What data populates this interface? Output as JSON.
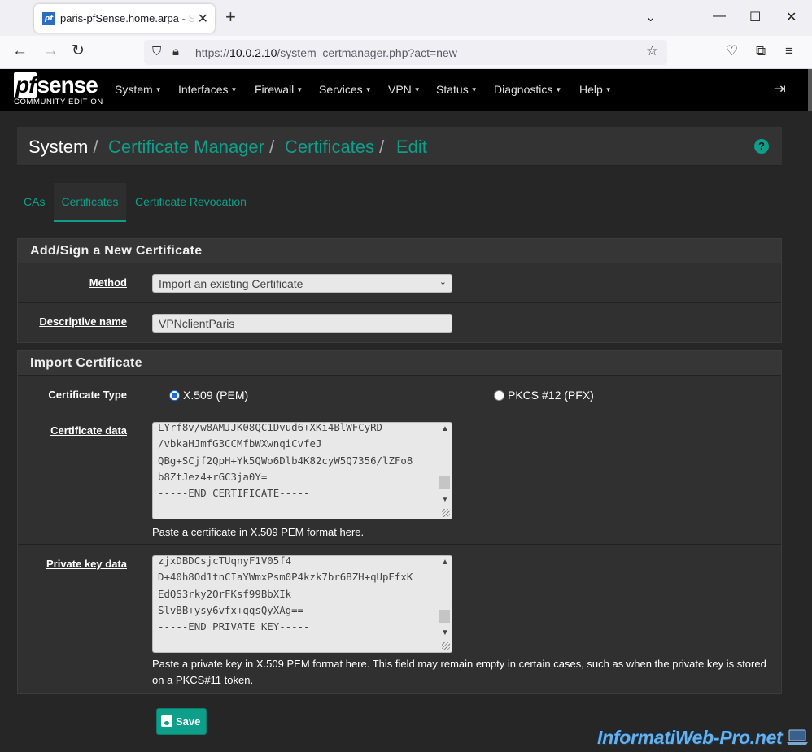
{
  "browser": {
    "tab_title": "paris-pfSense.home.arpa - System",
    "favicon_text": "pf",
    "new_tab": "+",
    "url_prefix": "https://",
    "url_host": "10.0.2.10",
    "url_path": "/system_certmanager.php?act=new"
  },
  "pfsense": {
    "logo_mark_pf": "pf",
    "logo_mark_sense": "sense",
    "logo_edition": "COMMUNITY EDITION",
    "menu": [
      "System",
      "Interfaces",
      "Firewall",
      "Services",
      "VPN",
      "Status",
      "Diagnostics",
      "Help"
    ]
  },
  "breadcrumb": {
    "root": "System",
    "items": [
      "Certificate Manager",
      "Certificates",
      "Edit"
    ]
  },
  "tabs": [
    "CAs",
    "Certificates",
    "Certificate Revocation"
  ],
  "active_tab": "Certificates",
  "add_panel": {
    "title": "Add/Sign a New Certificate",
    "method_label": "Method",
    "method_value": "Import an existing Certificate",
    "descr_label": "Descriptive name",
    "descr_value": "VPNclientParis"
  },
  "import_panel": {
    "title": "Import Certificate",
    "type_label": "Certificate Type",
    "type_options": [
      "X.509 (PEM)",
      "PKCS #12 (PFX)"
    ],
    "type_selected": "X.509 (PEM)",
    "cert_label": "Certificate data",
    "cert_lines": [
      "LYrf8v/w8AMJJK08QC1Dvud6+XKi4BlWFCyRD",
      "/vbkaHJmfG3CCMfbWXwnqiCvfeJ",
      "QBg+SCjf2QpH+Yk5QWo6Dlb4K82cyW5Q7356/lZFo8",
      "b8ZtJez4+rGC3ja0Y=",
      "-----END CERTIFICATE-----"
    ],
    "cert_help": "Paste a certificate in X.509 PEM format here.",
    "key_label": "Private key data",
    "key_lines": [
      "zjxDBDCsjcTUqnyF1V05f4",
      "D+40h8Od1tnCIaYWmxPsm0P4kzk7br6BZH+qUpEfxK",
      "EdQS3rky2OrFKsf99BbXIk",
      "SlvBB+ysy6vfx+qqsQyXAg==",
      "-----END PRIVATE KEY-----"
    ],
    "key_help": "Paste a private key in X.509 PEM format here. This field may remain empty in certain cases, such as when the private key is stored on a PKCS#11 token."
  },
  "save_label": "Save",
  "watermark": "InformatiWeb-Pro.net",
  "colors": {
    "accent": "#0d9f8a",
    "navbar": "#000000",
    "panel": "#303030"
  }
}
